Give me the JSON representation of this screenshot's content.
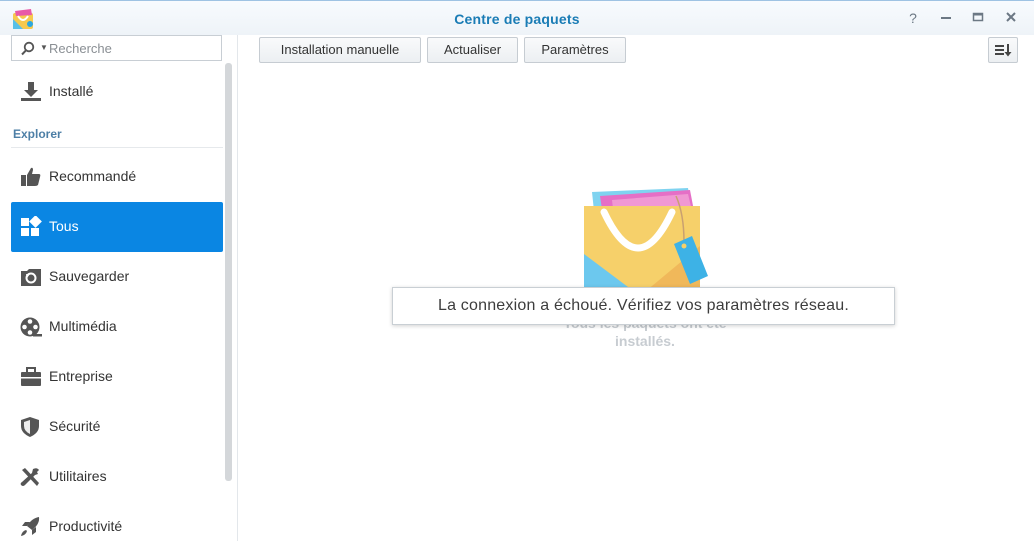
{
  "window": {
    "title": "Centre de paquets",
    "controls": [
      "help-icon",
      "minimize-icon",
      "maximize-icon",
      "close-icon"
    ]
  },
  "sidebar": {
    "search_placeholder": "Recherche",
    "installed": {
      "label": "Installé",
      "icon": "download-icon"
    },
    "section_label": "Explorer",
    "items": [
      {
        "label": "Recommandé",
        "icon": "thumbs-up-icon"
      },
      {
        "label": "Tous",
        "icon": "grid-icon",
        "active": true
      },
      {
        "label": "Sauvegarder",
        "icon": "backup-icon"
      },
      {
        "label": "Multimédia",
        "icon": "film-reel-icon"
      },
      {
        "label": "Entreprise",
        "icon": "briefcase-icon"
      },
      {
        "label": "Sécurité",
        "icon": "shield-icon"
      },
      {
        "label": "Utilitaires",
        "icon": "tools-icon"
      },
      {
        "label": "Productivité",
        "icon": "rocket-icon"
      }
    ]
  },
  "toolbar": {
    "manual_install": "Installation manuelle",
    "refresh": "Actualiser",
    "settings": "Paramètres",
    "sort_icon": "sort-icon"
  },
  "main": {
    "empty_text_line1": "Tous les paquets ont été",
    "empty_text_line2": "installés.",
    "error_message": "La connexion a échoué. Vérifiez vos paramètres réseau."
  },
  "colors": {
    "accent": "#0a86e3",
    "title": "#1a7cb5",
    "section": "#4d7fa6"
  }
}
